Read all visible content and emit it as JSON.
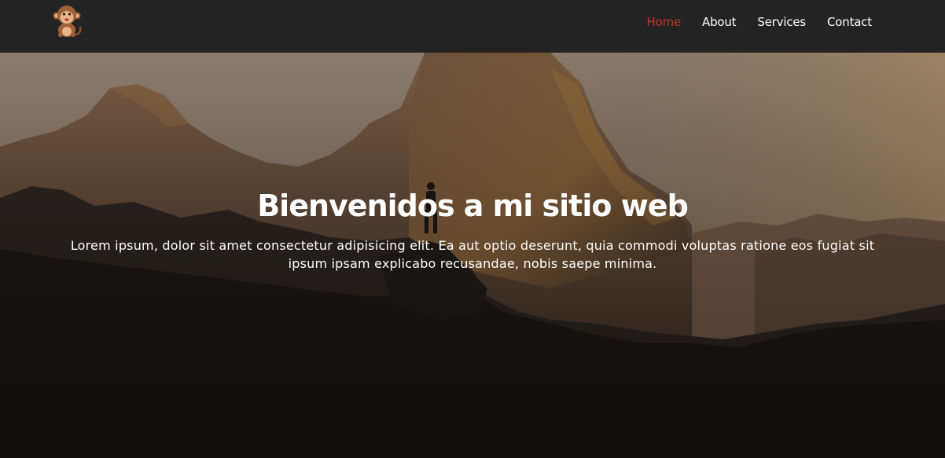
{
  "navbar": {
    "logo_icon": "monkey-logo-icon",
    "links": [
      {
        "label": "Home",
        "active": true
      },
      {
        "label": "About",
        "active": false
      },
      {
        "label": "Services",
        "active": false
      },
      {
        "label": "Contact",
        "active": false
      }
    ],
    "active_color": "#c0392b",
    "background": "#232323"
  },
  "hero": {
    "title": "Bienvenidos a mi sitio web",
    "text": "Lorem ipsum, dolor sit amet consectetur adipisicing elit. Ea aut optio deserunt, quia commodi voluptas ratione eos fugiat sit ipsum ipsam explicabo recusandae, nobis saepe minima.",
    "background_image": "mountain-silhouette-sunset"
  }
}
